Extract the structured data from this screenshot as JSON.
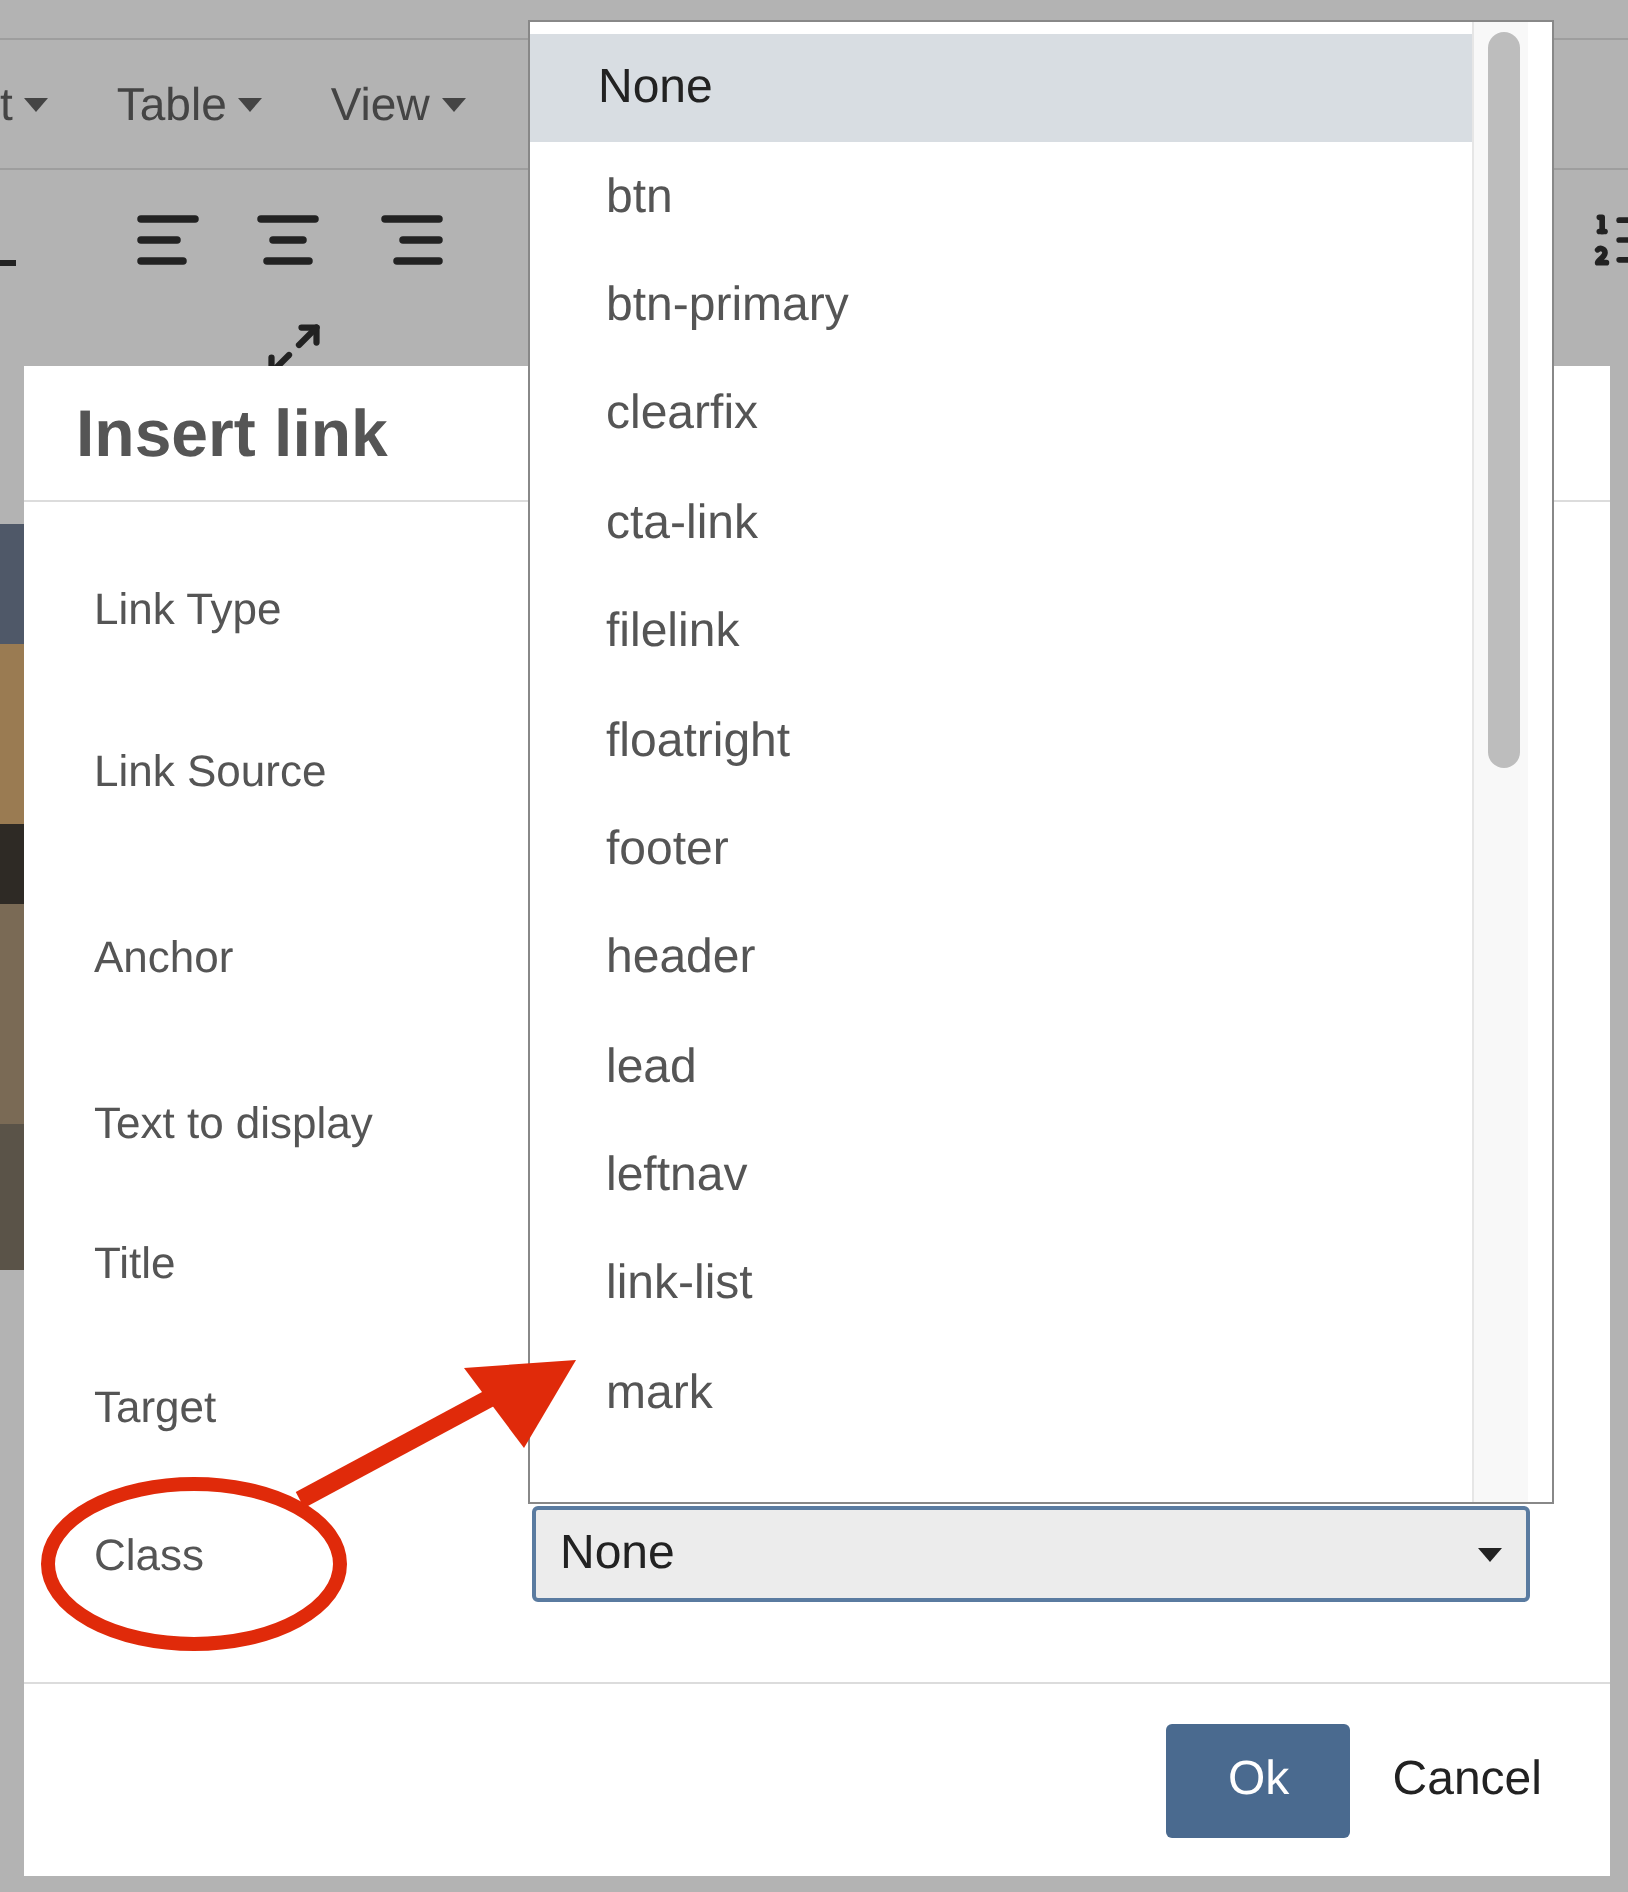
{
  "menubar": [
    {
      "label": "t"
    },
    {
      "label": "Table"
    },
    {
      "label": "View"
    }
  ],
  "dialog": {
    "title": "Insert link",
    "fields": [
      "Link Type",
      "Link Source",
      "Anchor",
      "Text to display",
      "Title",
      "Target",
      "Class"
    ],
    "class_select": {
      "value": "None",
      "expanded": true
    },
    "buttons": [
      {
        "label": "Ok",
        "kind": "primary"
      },
      {
        "label": "Cancel",
        "kind": "secondary"
      }
    ]
  },
  "dropdown": {
    "options": [
      {
        "label": "None",
        "selected": true
      },
      {
        "label": "btn",
        "selected": false
      },
      {
        "label": "btn-primary",
        "selected": false
      },
      {
        "label": "clearfix",
        "selected": false
      },
      {
        "label": "cta-link",
        "selected": false
      },
      {
        "label": "filelink",
        "selected": false
      },
      {
        "label": "floatright",
        "selected": false
      },
      {
        "label": "footer",
        "selected": false
      },
      {
        "label": "header",
        "selected": false
      },
      {
        "label": "lead",
        "selected": false
      },
      {
        "label": "leftnav",
        "selected": false
      },
      {
        "label": "link-list",
        "selected": false
      },
      {
        "label": "mark",
        "selected": false
      }
    ]
  }
}
